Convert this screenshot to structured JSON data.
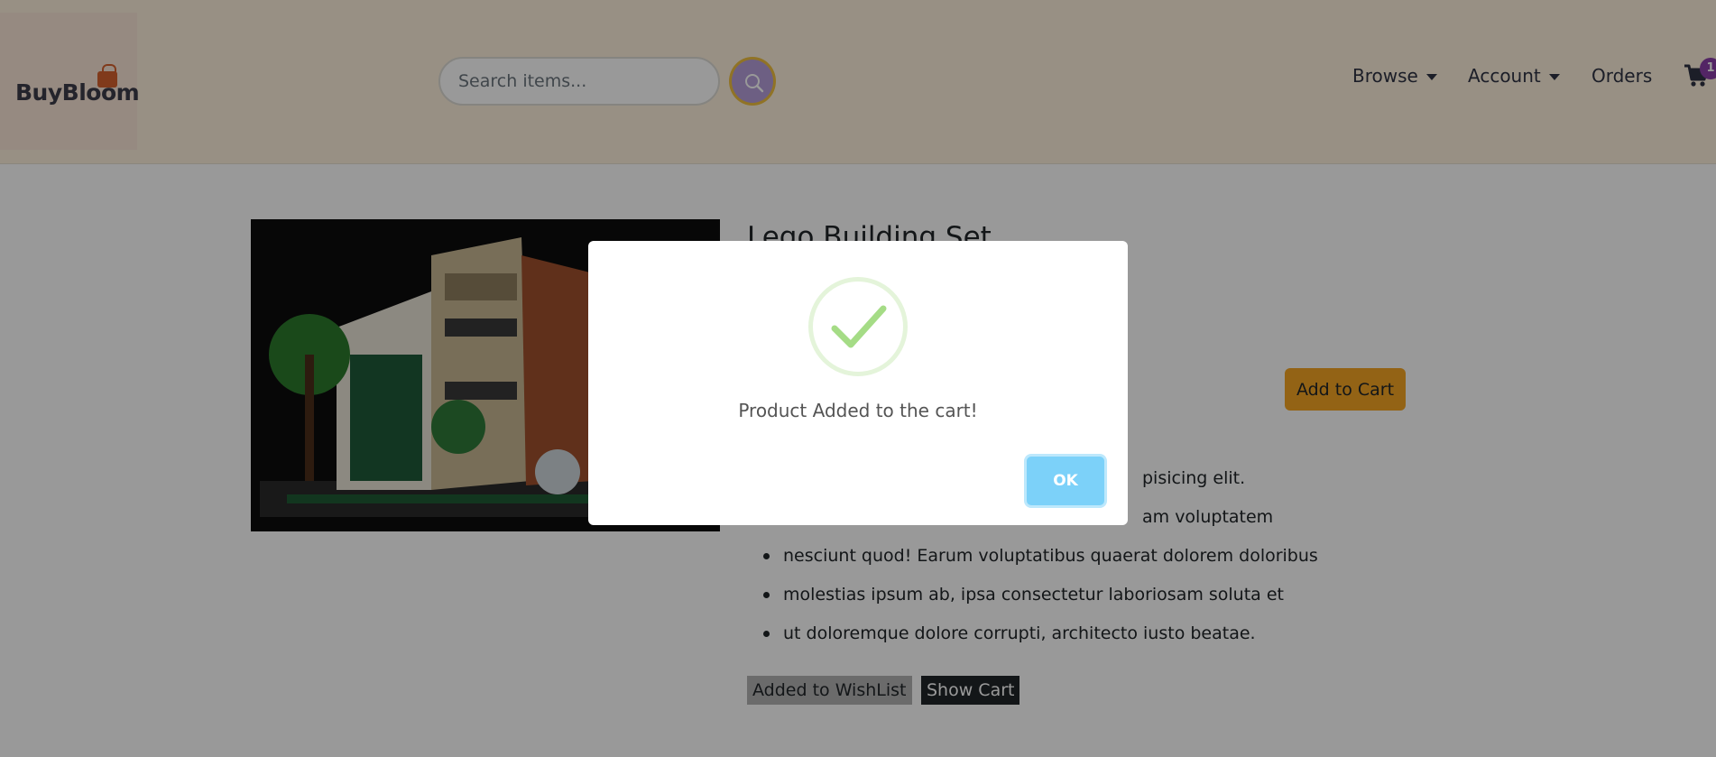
{
  "header": {
    "logo_text": "BuyBloom",
    "search": {
      "placeholder": "Search items..."
    },
    "nav": {
      "browse": "Browse",
      "account": "Account",
      "orders": "Orders"
    },
    "cart_count": "1"
  },
  "product": {
    "title": "Lego Building Set",
    "add_to_cart_label": "Add to Cart",
    "description": [
      "pisicing elit.",
      "am voluptatem",
      "nesciunt quod! Earum voluptatibus quaerat dolorem doloribus",
      "molestias ipsum ab, ipsa consectetur laboriosam soluta et",
      "ut doloremque dolore corrupti, architecto iusto beatae."
    ],
    "wishlist_label": "Added to WishList",
    "show_cart_label": "Show Cart"
  },
  "modal": {
    "message": "Product Added to the cart!",
    "ok_label": "OK"
  },
  "colors": {
    "header_bg": "#fdf1dc",
    "accent_orange": "#f5a623",
    "success_green": "#a5dc86",
    "ok_blue": "#7cd1f9"
  }
}
